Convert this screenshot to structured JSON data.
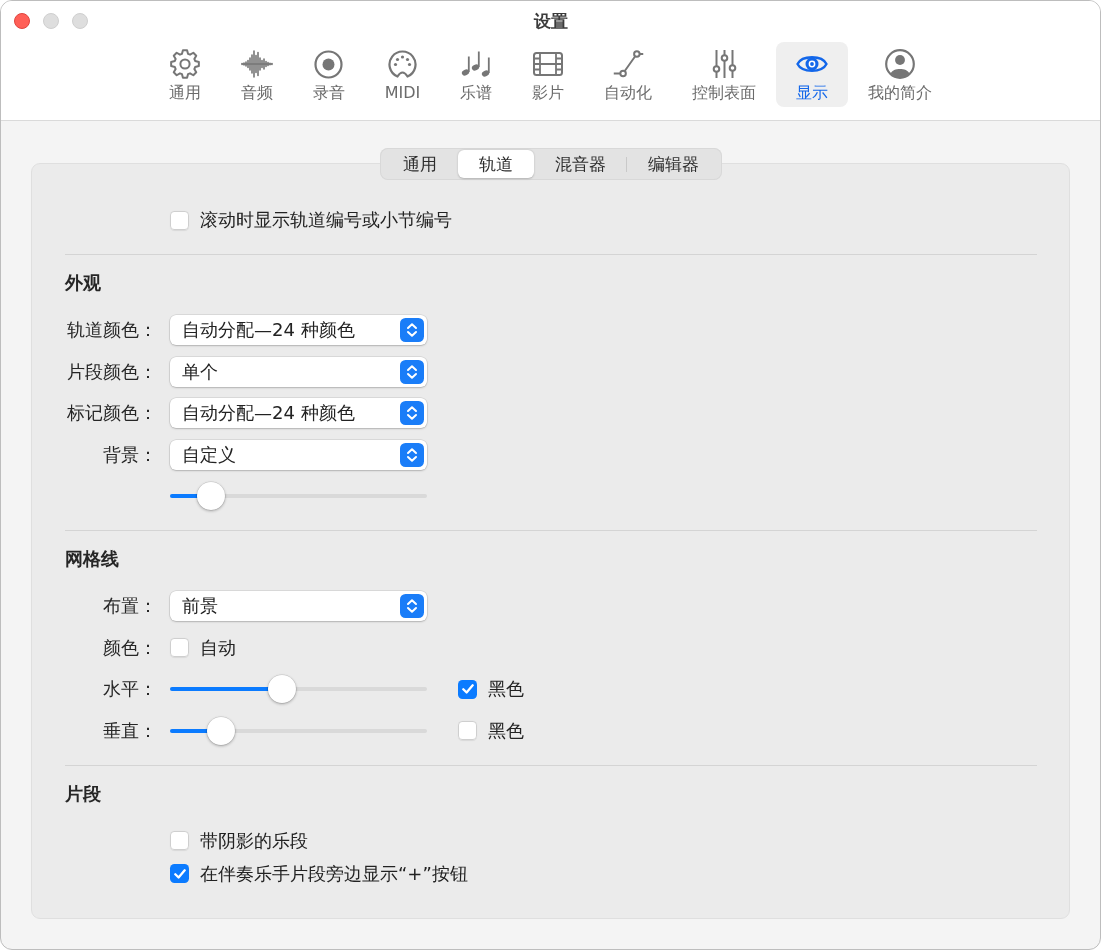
{
  "window": {
    "title": "设置"
  },
  "toolbar": [
    {
      "label": "通用",
      "selected": false
    },
    {
      "label": "音频",
      "selected": false
    },
    {
      "label": "录音",
      "selected": false
    },
    {
      "label": "MIDI",
      "selected": false
    },
    {
      "label": "乐谱",
      "selected": false
    },
    {
      "label": "影片",
      "selected": false
    },
    {
      "label": "自动化",
      "selected": false
    },
    {
      "label": "控制表面",
      "selected": false
    },
    {
      "label": "显示",
      "selected": true
    },
    {
      "label": "我的简介",
      "selected": false
    }
  ],
  "tabs": [
    {
      "label": "通用",
      "selected": false
    },
    {
      "label": "轨道",
      "selected": true
    },
    {
      "label": "混音器",
      "selected": false
    },
    {
      "label": "编辑器",
      "selected": false
    }
  ],
  "sections": [
    {
      "rows": [
        {
          "kind": "checkbox",
          "text": "滚动时显示轨道编号或小节编号",
          "checked": false
        }
      ]
    },
    {
      "heading": "外观",
      "rows": [
        {
          "kind": "popup",
          "label": "轨道颜色：",
          "value": "自动分配—24 种颜色"
        },
        {
          "kind": "popup",
          "label": "片段颜色：",
          "value": "单个"
        },
        {
          "kind": "popup",
          "label": "标记颜色：",
          "value": "自动分配—24 种颜色"
        },
        {
          "kind": "popup",
          "label": "背景：",
          "value": "自定义"
        },
        {
          "kind": "slider",
          "level": 0.12
        }
      ]
    },
    {
      "heading": "网格线",
      "rows": [
        {
          "kind": "popup",
          "label": "布置：",
          "value": "前景"
        },
        {
          "kind": "checkbox",
          "label": "颜色：",
          "text": "自动",
          "checked": false
        },
        {
          "kind": "slider",
          "label": "水平：",
          "level": 0.43,
          "option": {
            "text": "黑色",
            "checked": true
          }
        },
        {
          "kind": "slider",
          "label": "垂直：",
          "level": 0.16,
          "option": {
            "text": "黑色",
            "checked": false
          }
        }
      ]
    },
    {
      "heading": "片段",
      "rows": [
        {
          "kind": "checkbox",
          "text": "带阴影的乐段",
          "checked": false
        },
        {
          "kind": "checkbox",
          "text": "在伴奏乐手片段旁边显示“+”按钮",
          "checked": true
        }
      ]
    }
  ]
}
